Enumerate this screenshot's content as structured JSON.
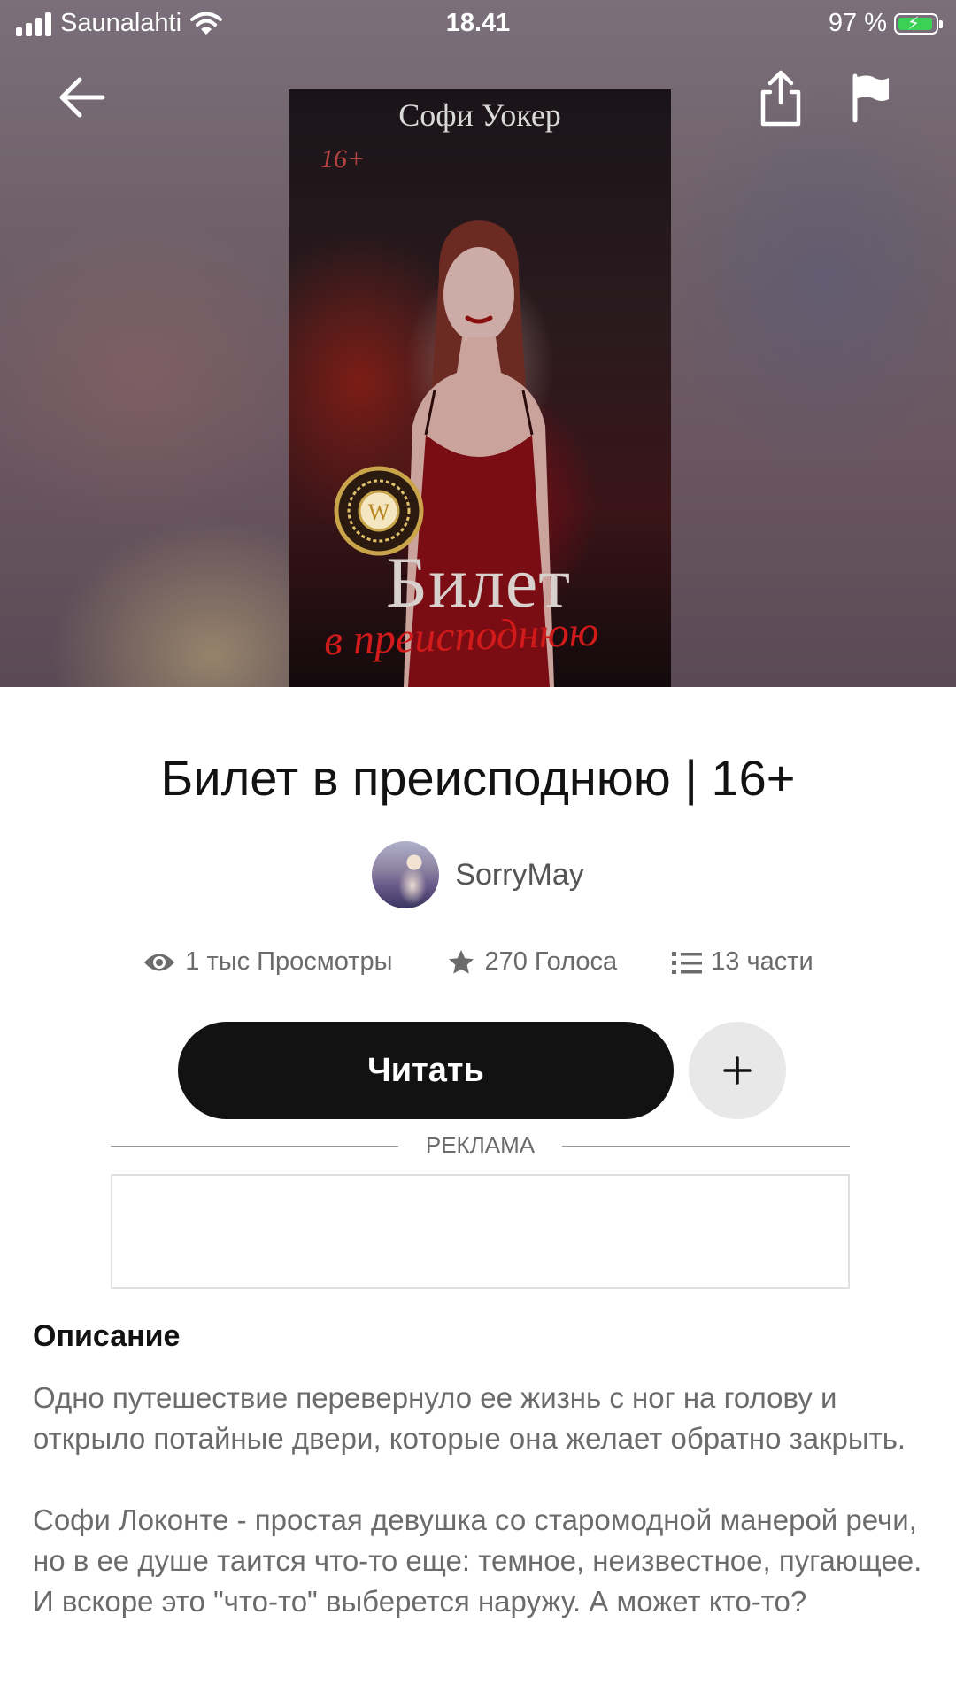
{
  "status_bar": {
    "carrier": "Saunalahti",
    "time": "18.41",
    "battery": "97 %",
    "battery_level": 0.97
  },
  "nav": {
    "back_icon": "arrow-left-icon",
    "share_icon": "share-icon",
    "report_icon": "flag-icon"
  },
  "cover": {
    "author": "Софи Уокер",
    "age_badge": "16+",
    "title_line1": "Билет",
    "title_line2": "в преисподнюю",
    "seal_letter": "W"
  },
  "book": {
    "title": "Билет в преисподнюю | 16+",
    "author": "SorryMay"
  },
  "stats": {
    "views": "1 тыс Просмотры",
    "votes": "270 Голоса",
    "parts": "13 части"
  },
  "actions": {
    "read_label": "Читать",
    "add_label": "+"
  },
  "ad": {
    "label": "РЕКЛАМА"
  },
  "description": {
    "heading": "Описание",
    "paragraphs": [
      "Одно путешествие перевернуло ее жизнь с ног на голову и открыло потайные двери, которые она желает обратно закрыть.",
      "Софи Локонте - простая девушка со старомодной манерой речи, но в ее душе таится что-то еще: темное, неизвестное, пугающее. И вскоре это \"что-то\" выберется наружу. А может кто-то?"
    ]
  }
}
